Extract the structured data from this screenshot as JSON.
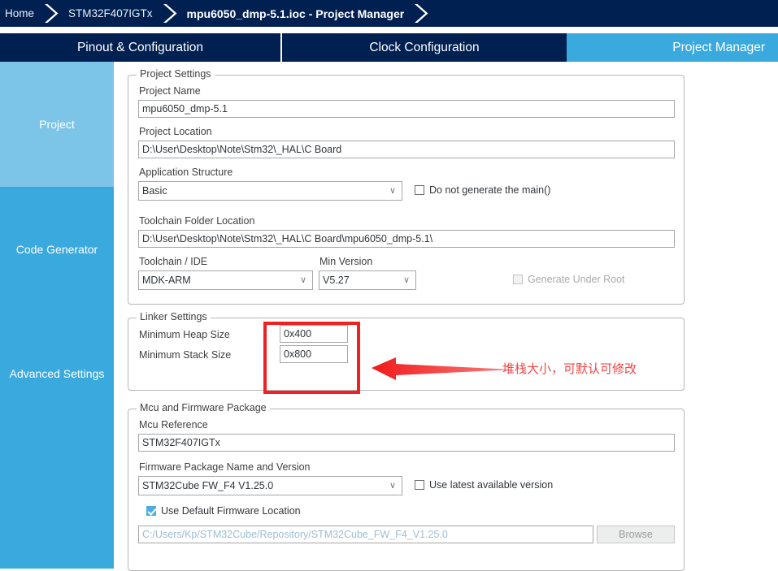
{
  "breadcrumb": {
    "home": "Home",
    "device": "STM32F407IGTx",
    "current": "mpu6050_dmp-5.1.ioc - Project Manager"
  },
  "tabs": {
    "pinout": "Pinout & Configuration",
    "clock": "Clock Configuration",
    "project_manager": "Project Manager"
  },
  "sidebar": {
    "items": [
      {
        "label": "Project"
      },
      {
        "label": "Code Generator"
      },
      {
        "label": "Advanced Settings"
      },
      {
        "label": ""
      }
    ]
  },
  "project_settings": {
    "group_title": "Project Settings",
    "project_name_label": "Project Name",
    "project_name_value": "mpu6050_dmp-5.1",
    "project_location_label": "Project Location",
    "project_location_value": "D:\\User\\Desktop\\Note\\Stm32\\_HAL\\C Board",
    "application_structure_label": "Application Structure",
    "application_structure_value": "Basic",
    "do_not_generate_main_label": "Do not generate the main()",
    "do_not_generate_main_checked": false,
    "toolchain_folder_label": "Toolchain Folder Location",
    "toolchain_folder_value": "D:\\User\\Desktop\\Note\\Stm32\\_HAL\\C Board\\mpu6050_dmp-5.1\\",
    "toolchain_ide_label": "Toolchain / IDE",
    "toolchain_ide_value": "MDK-ARM",
    "min_version_label": "Min Version",
    "min_version_value": "V5.27",
    "generate_under_root_label": "Generate Under Root",
    "generate_under_root_checked": false
  },
  "linker_settings": {
    "group_title": "Linker Settings",
    "min_heap_label": "Minimum Heap Size",
    "min_heap_value": "0x400",
    "min_stack_label": "Minimum Stack Size",
    "min_stack_value": "0x800"
  },
  "mcu_firmware": {
    "group_title": "Mcu and Firmware Package",
    "mcu_reference_label": "Mcu Reference",
    "mcu_reference_value": "STM32F407IGTx",
    "firmware_package_label": "Firmware Package Name and Version",
    "firmware_package_value": "STM32Cube FW_F4 V1.25.0",
    "use_latest_label": "Use latest available version",
    "use_latest_checked": false,
    "use_default_location_label": "Use Default Firmware Location",
    "use_default_location_checked": true,
    "firmware_path_value": "C:/Users/Kp/STM32Cube/Repository/STM32Cube_FW_F4_V1.25.0",
    "browse_label": "Browse"
  },
  "annotation": {
    "note_text": "堆栈大小，可默认可修改",
    "color": "#f04545",
    "highlight_color": "#ee2222"
  },
  "colors": {
    "header_navy": "#002052",
    "accent_blue": "#3AA9DE",
    "accent_blue_light": "#7CC5E8"
  },
  "icons": {
    "chevron_down": "∨"
  }
}
